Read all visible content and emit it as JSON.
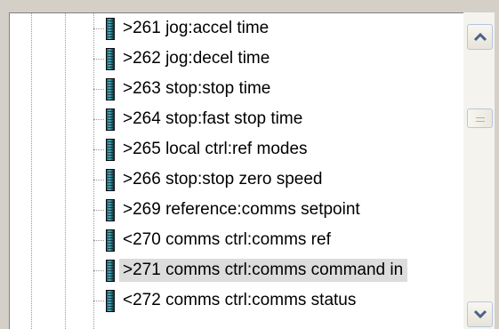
{
  "tree": {
    "items": [
      {
        "label": ">261 jog:accel time",
        "icon": "parameter-icon",
        "selected": false
      },
      {
        "label": ">262 jog:decel time",
        "icon": "parameter-icon",
        "selected": false
      },
      {
        "label": ">263 stop:stop time",
        "icon": "parameter-icon",
        "selected": false
      },
      {
        "label": ">264 stop:fast stop time",
        "icon": "parameter-icon",
        "selected": false
      },
      {
        "label": ">265 local ctrl:ref modes",
        "icon": "parameter-icon",
        "selected": false
      },
      {
        "label": ">266 stop:stop zero speed",
        "icon": "parameter-icon",
        "selected": false
      },
      {
        "label": ">269 reference:comms setpoint",
        "icon": "parameter-icon",
        "selected": false
      },
      {
        "label": "<270 comms ctrl:comms ref",
        "icon": "parameter-icon",
        "selected": false
      },
      {
        "label": ">271 comms ctrl:comms command in",
        "icon": "parameter-icon",
        "selected": true
      },
      {
        "label": "<272 comms ctrl:comms status",
        "icon": "parameter-icon",
        "selected": false
      }
    ]
  },
  "scrollbar": {
    "up_icon": "scroll-up-arrow-icon",
    "down_icon": "scroll-down-arrow-icon",
    "position_fraction": 0.31
  },
  "colors": {
    "selection": "#dcdcdc",
    "icon_teal": "#4fb0c0",
    "scroll_border": "#b7c4e2"
  }
}
